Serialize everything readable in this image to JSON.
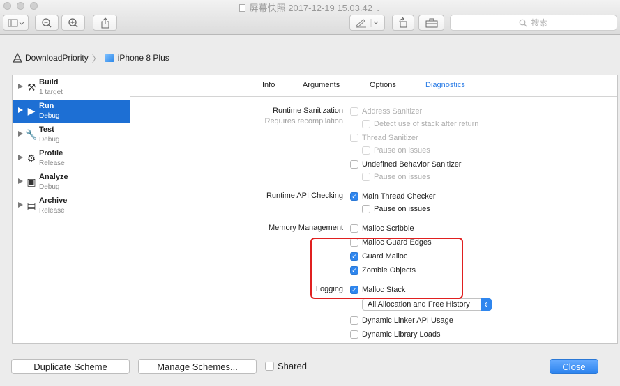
{
  "window": {
    "title": "屏幕快照 2017-12-19 15.03.42"
  },
  "toolbar": {
    "search_placeholder": "搜索",
    "zoom_out": "−",
    "zoom_in": "+"
  },
  "breadcrumb": {
    "project": "DownloadPriority",
    "device": "iPhone 8 Plus"
  },
  "sidebar": {
    "items": [
      {
        "name": "Build",
        "sub": "1 target",
        "icon": "hammer-icon",
        "glyph": "⚒"
      },
      {
        "name": "Run",
        "sub": "Debug",
        "icon": "play-icon",
        "glyph": "▶",
        "selected": true
      },
      {
        "name": "Test",
        "sub": "Debug",
        "icon": "wrench-icon",
        "glyph": "🔧"
      },
      {
        "name": "Profile",
        "sub": "Release",
        "icon": "instruments-icon",
        "glyph": "⚙"
      },
      {
        "name": "Analyze",
        "sub": "Debug",
        "icon": "analyze-icon",
        "glyph": "▣"
      },
      {
        "name": "Archive",
        "sub": "Release",
        "icon": "archive-icon",
        "glyph": "▤"
      }
    ]
  },
  "tabs": [
    "Info",
    "Arguments",
    "Options",
    "Diagnostics"
  ],
  "active_tab": "Diagnostics",
  "sections": {
    "runtime_sanitization": {
      "label": "Runtime Sanitization",
      "sub": "Requires recompilation",
      "options": [
        {
          "label": "Address Sanitizer",
          "checked": false,
          "enabled": false
        },
        {
          "label": "Detect use of stack after return",
          "checked": false,
          "enabled": false
        },
        {
          "label": "Thread Sanitizer",
          "checked": false,
          "enabled": false
        },
        {
          "label": "Pause on issues",
          "checked": false,
          "enabled": false
        },
        {
          "label": "Undefined Behavior Sanitizer",
          "checked": false,
          "enabled": true
        },
        {
          "label": "Pause on issues",
          "checked": false,
          "enabled": false
        }
      ]
    },
    "runtime_api": {
      "label": "Runtime API Checking",
      "options": [
        {
          "label": "Main Thread Checker",
          "checked": true,
          "enabled": true
        },
        {
          "label": "Pause on issues",
          "checked": false,
          "enabled": true
        }
      ]
    },
    "memory": {
      "label": "Memory Management",
      "options": [
        {
          "label": "Malloc Scribble",
          "checked": false,
          "enabled": true
        },
        {
          "label": "Malloc Guard Edges",
          "checked": false,
          "enabled": true
        },
        {
          "label": "Guard Malloc",
          "checked": true,
          "enabled": true
        },
        {
          "label": "Zombie Objects",
          "checked": true,
          "enabled": true
        }
      ]
    },
    "logging": {
      "label": "Logging",
      "options": [
        {
          "label": "Malloc Stack",
          "checked": true,
          "enabled": true
        },
        {
          "label": "Dynamic Linker API Usage",
          "checked": false,
          "enabled": true
        },
        {
          "label": "Dynamic Library Loads",
          "checked": false,
          "enabled": true
        }
      ],
      "history_popup": "All Allocation and Free History"
    }
  },
  "footer": {
    "duplicate": "Duplicate Scheme",
    "manage": "Manage Schemes...",
    "shared": "Shared",
    "shared_checked": false,
    "close": "Close"
  },
  "colors": {
    "accent": "#2f86ee",
    "selection": "#1d6fd4",
    "highlight_box": "#e02020"
  }
}
